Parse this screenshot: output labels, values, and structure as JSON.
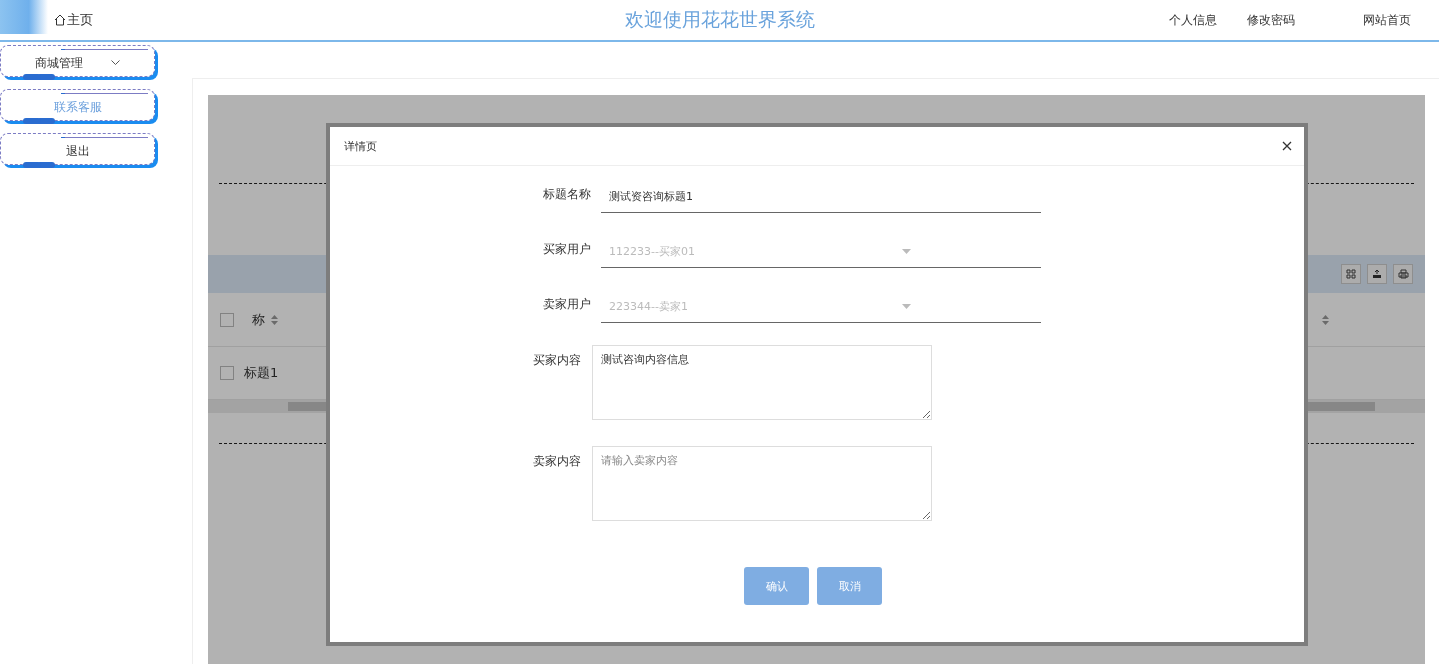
{
  "header": {
    "home_link": "主页",
    "title": "欢迎使用花花世界系统",
    "links": [
      "个人信息",
      "修改密码",
      "网站首页"
    ]
  },
  "sidebar": {
    "items": [
      {
        "label": "商城管理",
        "selected": false,
        "expanded": false
      },
      {
        "label": "联系客服",
        "selected": true
      },
      {
        "label": "退出",
        "selected": false
      }
    ]
  },
  "table": {
    "header_cells": [
      "称"
    ],
    "rows": [
      {
        "cells": [
          "标题1"
        ],
        "checked": false
      }
    ],
    "header_checked": false
  },
  "modal": {
    "title": "详情页",
    "fields": [
      {
        "kind": "text",
        "label": "标题名称",
        "value": "测试资咨询标题1"
      },
      {
        "kind": "select",
        "label": "买家用户",
        "value": "112233--买家01",
        "disabled": true
      },
      {
        "kind": "select",
        "label": "卖家用户",
        "value": "223344--卖家1",
        "disabled": true
      },
      {
        "kind": "textarea",
        "label": "买家内容",
        "value": "测试咨询内容信息"
      },
      {
        "kind": "textarea",
        "label": "卖家内容",
        "placeholder": "请输入卖家内容"
      }
    ],
    "buttons": [
      "确认",
      "取消"
    ]
  }
}
